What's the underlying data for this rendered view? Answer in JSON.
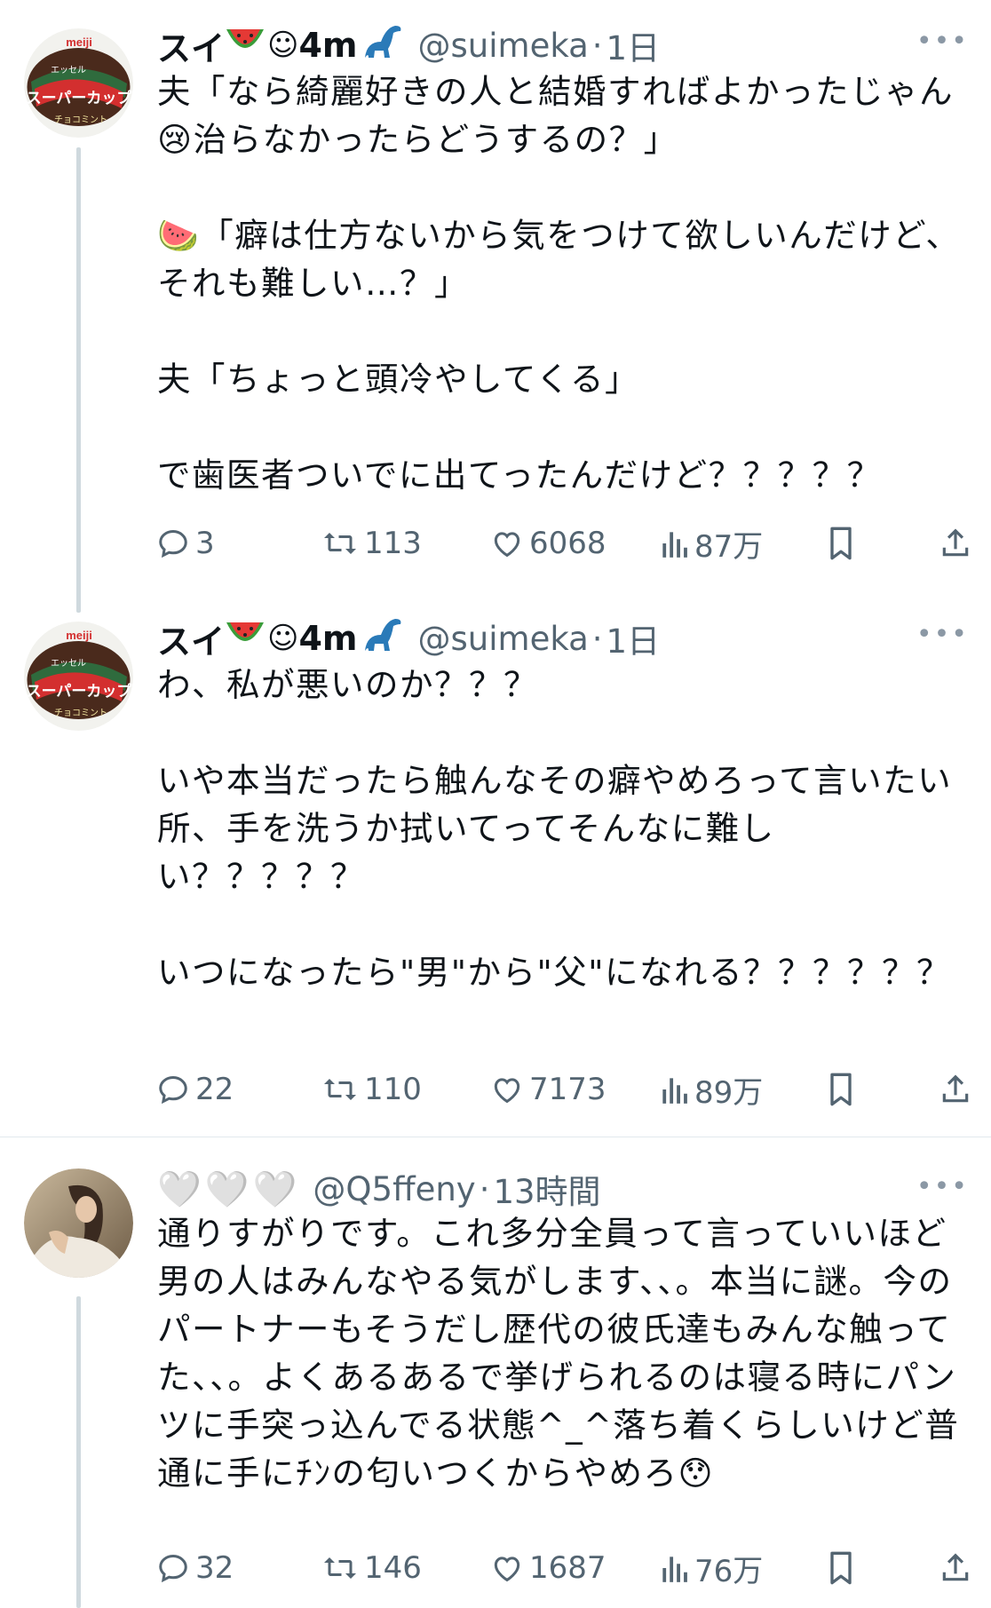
{
  "tweets": [
    {
      "user_name": "スイ",
      "name_tail": "4m",
      "handle": "@suimeka",
      "separator": "·",
      "time": "1日",
      "text": "夫「なら綺麗好きの人と結婚すればよかったじゃん\n😢治らなかったらどうするの？」\n\n🍉「癖は仕方ないから気をつけて欲しいんだけど、それも難しい…？」\n\n夫「ちょっと頭冷やしてくる」\n\nで歯医者ついでに出てったんだけど？？？？？",
      "replies": "3",
      "retweets": "113",
      "likes": "6068",
      "views": "87万"
    },
    {
      "user_name": "スイ",
      "name_tail": "4m",
      "handle": "@suimeka",
      "separator": "·",
      "time": "1日",
      "text": "わ、私が悪いのか？？？\n\nいや本当だったら触んなその癖やめろって言いたい所、手を洗うか拭いてってそんなに難しい？？？？？\n\nいつになったら\"男\"から\"父\"になれる？？？？？？",
      "replies": "22",
      "retweets": "110",
      "likes": "7173",
      "views": "89万"
    },
    {
      "user_name": "🤍🤍🤍",
      "handle": "@Q5ffeny",
      "separator": "·",
      "time": "13時間",
      "text": "通りすがりです。これ多分全員って言っていいほど男の人はみんなやる気がします、、。本当に謎。今のパートナーもそうだし歴代の彼氏達もみんな触ってた、、。よくあるあるで挙げられるのは寝る時にパンツに手突っ込んでる状態^_^落ち着くらしいけど普通に手にﾁﾝの匂いつくからやめろ😯",
      "replies": "32",
      "retweets": "146",
      "likes": "1687",
      "views": "76万"
    }
  ],
  "more_label": "•••",
  "colors": {
    "text": "#0f1419",
    "secondary": "#536471",
    "line": "#cfd9de"
  },
  "icons": [
    "reply-icon",
    "retweet-icon",
    "like-icon",
    "views-icon",
    "bookmark-icon",
    "share-icon"
  ]
}
